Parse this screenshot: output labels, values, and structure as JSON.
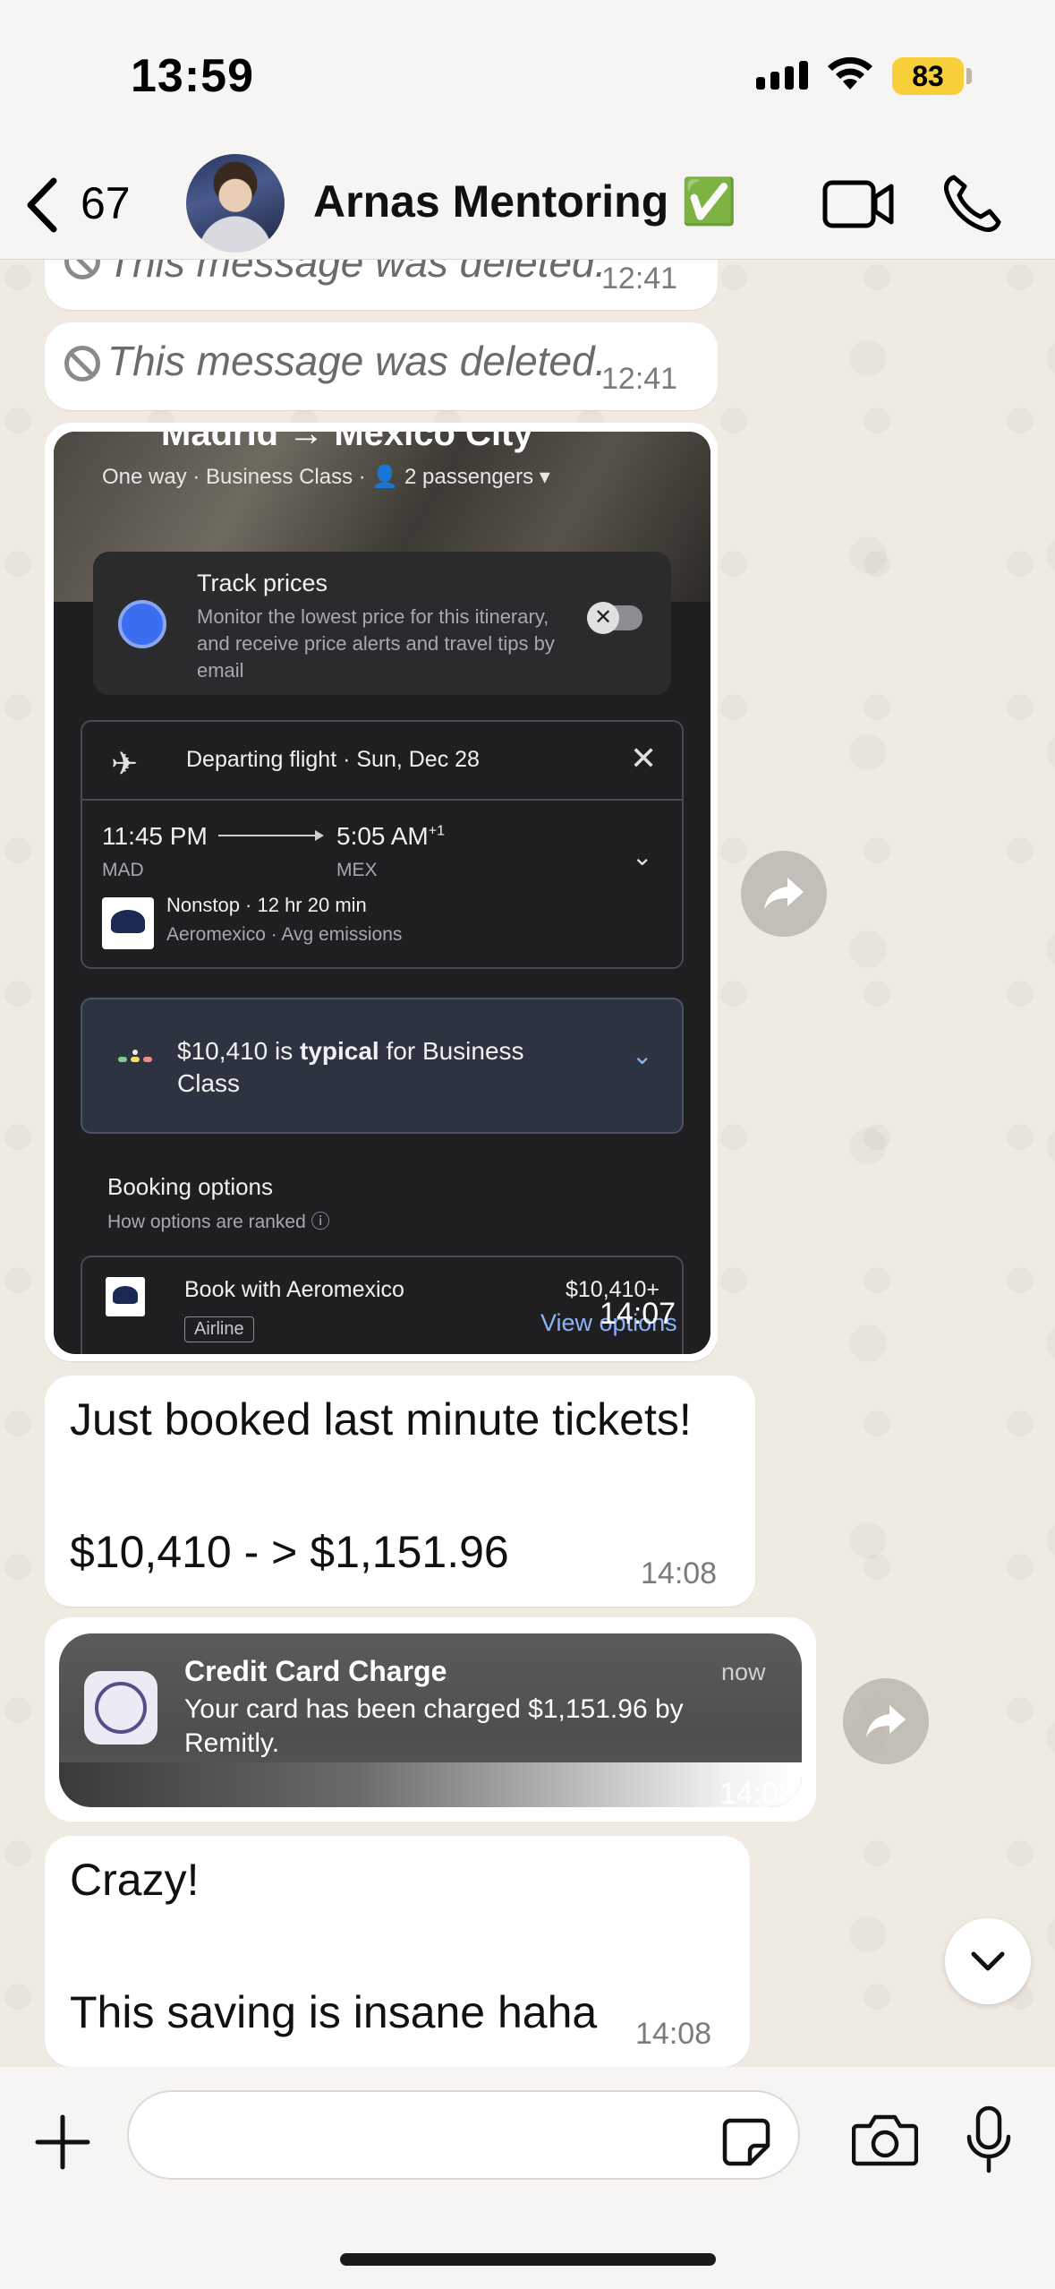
{
  "status_bar": {
    "time": "13:59",
    "battery": "83"
  },
  "header": {
    "back_count": "67",
    "title": "Arnas Mentoring ✅"
  },
  "messages": {
    "deleted_1": {
      "text": "This message was deleted.",
      "time": "12:41"
    },
    "deleted_2": {
      "text": "This message was deleted.",
      "time": "12:41"
    },
    "image": {
      "time": "14:07",
      "route": "Madrid → Mexico City",
      "meta": "One way · Business Class ·  👤 2 passengers  ▾",
      "track_title": "Track prices",
      "track_desc": "Monitor the lowest price for this itinerary, and receive price alerts and travel tips by email",
      "flight_header": "Departing flight · Sun, Dec 28",
      "dep_time": "11:45 PM",
      "arr_time": "5:05 AM",
      "arr_sup": "+1",
      "dep_code": "MAD",
      "arr_code": "MEX",
      "nonstop": "Nonstop · 12 hr 20 min",
      "airline_sub": "Aeromexico · Avg emissions",
      "price_prefix": "$10,410 is ",
      "price_bold": "typical",
      "price_suffix": " for Business Class",
      "booking_title": "Booking options",
      "booking_sub": "How options are ranked ⓘ",
      "book_with": "Book with Aeromexico",
      "book_price": "$10,410+",
      "airline_tag": "Airline",
      "view_options": "View options"
    },
    "text_1": {
      "text": "Just booked last minute tickets!\n\n$10,410 - > $1,151.96",
      "time": "14:08"
    },
    "notification": {
      "title": "Credit Card Charge",
      "when": "now",
      "body": "Your card has been charged $1,151.96 by Remitly.",
      "time": "14:08"
    },
    "text_2": {
      "text": "Crazy!\n\nThis saving is insane haha",
      "time": "14:08"
    }
  },
  "input": {
    "placeholder": ""
  },
  "colors": {
    "chat_background": "#efeae2",
    "bubble": "#ffffff",
    "link_blue": "#8ab4f8",
    "battery_yellow": "#f7cf3a"
  }
}
